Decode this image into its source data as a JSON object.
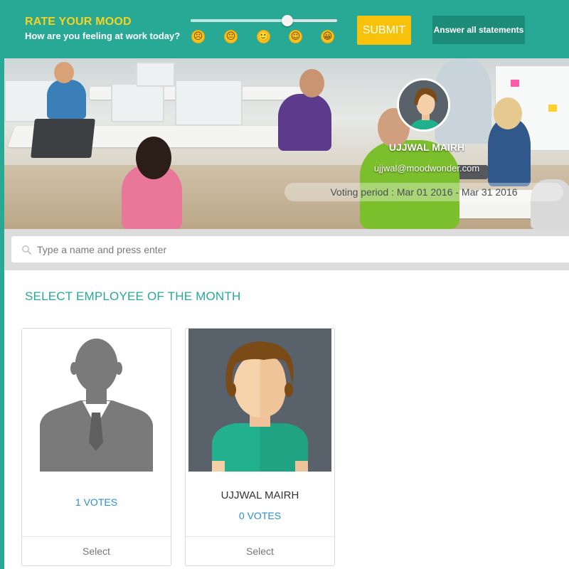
{
  "mood": {
    "title": "RATE YOUR MOOD",
    "subtitle": "How are you feeling at work today?",
    "slider_value": 0.66,
    "emoji_icons": [
      "frowning-face-icon",
      "neutral-face-icon",
      "slightly-happy-face-icon",
      "smiling-face-icon",
      "grinning-face-icon"
    ],
    "emojis": [
      "☹",
      "😐",
      "🙂",
      "☺",
      "😀"
    ],
    "submit_label": "SUBMIT",
    "answer_all_label": "Answer all statements"
  },
  "profile": {
    "name": "UJJWAL MAIRH",
    "email": "ujjwal@moodwonder.com",
    "voting_period": "Voting period : Mar 01 2016 - Mar 31 2016"
  },
  "search": {
    "placeholder": "Type a name and press enter",
    "icon": "search-icon"
  },
  "section": {
    "title": "SELECT EMPLOYEE OF THE MONTH"
  },
  "employees": [
    {
      "name": "",
      "votes": "1 VOTES",
      "select_label": "Select",
      "avatar": "default-silhouette"
    },
    {
      "name": "UJJWAL MAIRH",
      "votes": "0 VOTES",
      "select_label": "Select",
      "avatar": "user-avatar"
    }
  ],
  "colors": {
    "brand_teal": "#27a996",
    "mood_title_yellow": "#f7d21f",
    "submit_yellow": "#f9c20a",
    "answer_button": "#1c8b77",
    "votes_blue": "#2a8fd0"
  }
}
